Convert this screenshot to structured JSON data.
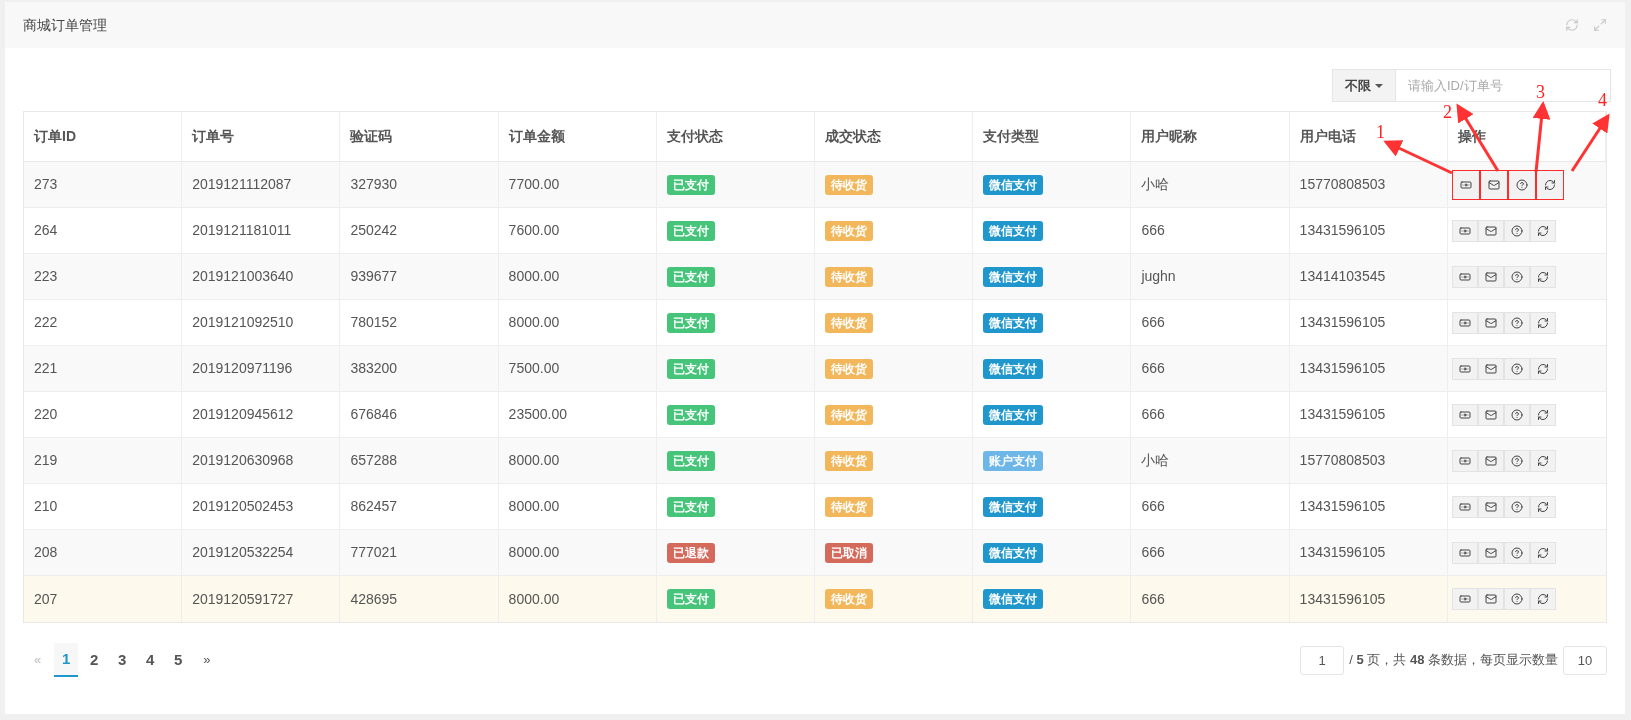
{
  "panel": {
    "title": "商城订单管理"
  },
  "filter": {
    "dropdown": "不限",
    "placeholder": "请输入ID/订单号"
  },
  "table": {
    "columns": [
      "订单ID",
      "订单号",
      "验证码",
      "订单金额",
      "支付状态",
      "成交状态",
      "支付类型",
      "用户昵称",
      "用户电话",
      "操作"
    ],
    "rows": [
      {
        "id": "273",
        "order_no": "2019121112087",
        "code": "327930",
        "amount": "7700.00",
        "pay_status": {
          "text": "已支付",
          "color": "#45c47a"
        },
        "deal_status": {
          "text": "待收货",
          "color": "#f2b65b"
        },
        "pay_type": {
          "text": "微信支付",
          "color": "#1f97cc"
        },
        "nickname": "小哈",
        "phone": "15770808503",
        "highlighted": false,
        "actions_marked": true
      },
      {
        "id": "264",
        "order_no": "2019121181011",
        "code": "250242",
        "amount": "7600.00",
        "pay_status": {
          "text": "已支付",
          "color": "#45c47a"
        },
        "deal_status": {
          "text": "待收货",
          "color": "#f2b65b"
        },
        "pay_type": {
          "text": "微信支付",
          "color": "#1f97cc"
        },
        "nickname": "666",
        "phone": "13431596105",
        "highlighted": false,
        "actions_marked": false
      },
      {
        "id": "223",
        "order_no": "2019121003640",
        "code": "939677",
        "amount": "8000.00",
        "pay_status": {
          "text": "已支付",
          "color": "#45c47a"
        },
        "deal_status": {
          "text": "待收货",
          "color": "#f2b65b"
        },
        "pay_type": {
          "text": "微信支付",
          "color": "#1f97cc"
        },
        "nickname": "jughn",
        "phone": "13414103545",
        "highlighted": false,
        "actions_marked": false
      },
      {
        "id": "222",
        "order_no": "2019121092510",
        "code": "780152",
        "amount": "8000.00",
        "pay_status": {
          "text": "已支付",
          "color": "#45c47a"
        },
        "deal_status": {
          "text": "待收货",
          "color": "#f2b65b"
        },
        "pay_type": {
          "text": "微信支付",
          "color": "#1f97cc"
        },
        "nickname": "666",
        "phone": "13431596105",
        "highlighted": false,
        "actions_marked": false
      },
      {
        "id": "221",
        "order_no": "2019120971196",
        "code": "383200",
        "amount": "7500.00",
        "pay_status": {
          "text": "已支付",
          "color": "#45c47a"
        },
        "deal_status": {
          "text": "待收货",
          "color": "#f2b65b"
        },
        "pay_type": {
          "text": "微信支付",
          "color": "#1f97cc"
        },
        "nickname": "666",
        "phone": "13431596105",
        "highlighted": false,
        "actions_marked": false
      },
      {
        "id": "220",
        "order_no": "2019120945612",
        "code": "676846",
        "amount": "23500.00",
        "pay_status": {
          "text": "已支付",
          "color": "#45c47a"
        },
        "deal_status": {
          "text": "待收货",
          "color": "#f2b65b"
        },
        "pay_type": {
          "text": "微信支付",
          "color": "#1f97cc"
        },
        "nickname": "666",
        "phone": "13431596105",
        "highlighted": false,
        "actions_marked": false
      },
      {
        "id": "219",
        "order_no": "2019120630968",
        "code": "657288",
        "amount": "8000.00",
        "pay_status": {
          "text": "已支付",
          "color": "#45c47a"
        },
        "deal_status": {
          "text": "待收货",
          "color": "#f2b65b"
        },
        "pay_type": {
          "text": "账户支付",
          "color": "#6cb6e8"
        },
        "nickname": "小哈",
        "phone": "15770808503",
        "highlighted": false,
        "actions_marked": false
      },
      {
        "id": "210",
        "order_no": "2019120502453",
        "code": "862457",
        "amount": "8000.00",
        "pay_status": {
          "text": "已支付",
          "color": "#45c47a"
        },
        "deal_status": {
          "text": "待收货",
          "color": "#f2b65b"
        },
        "pay_type": {
          "text": "微信支付",
          "color": "#1f97cc"
        },
        "nickname": "666",
        "phone": "13431596105",
        "highlighted": false,
        "actions_marked": false
      },
      {
        "id": "208",
        "order_no": "2019120532254",
        "code": "777021",
        "amount": "8000.00",
        "pay_status": {
          "text": "已退款",
          "color": "#d46a5c"
        },
        "deal_status": {
          "text": "已取消",
          "color": "#d46a5c"
        },
        "pay_type": {
          "text": "微信支付",
          "color": "#1f97cc"
        },
        "nickname": "666",
        "phone": "13431596105",
        "highlighted": false,
        "actions_marked": false
      },
      {
        "id": "207",
        "order_no": "2019120591727",
        "code": "428695",
        "amount": "8000.00",
        "pay_status": {
          "text": "已支付",
          "color": "#45c47a"
        },
        "deal_status": {
          "text": "待收货",
          "color": "#f2b65b"
        },
        "pay_type": {
          "text": "微信支付",
          "color": "#1f97cc"
        },
        "nickname": "666",
        "phone": "13431596105",
        "highlighted": true,
        "actions_marked": false
      }
    ]
  },
  "pagination": {
    "prev": "«",
    "next": "»",
    "pages": [
      {
        "label": "1",
        "selected": true
      },
      {
        "label": "2",
        "selected": false
      },
      {
        "label": "3",
        "selected": false
      },
      {
        "label": "4",
        "selected": false
      },
      {
        "label": "5",
        "selected": false
      }
    ],
    "current_page": "1",
    "summary": "/ **5** 页，共 **48** 条数据，每页显示数量",
    "page_size": "10"
  },
  "annotations": [
    {
      "label": "1"
    },
    {
      "label": "2"
    },
    {
      "label": "3"
    },
    {
      "label": "4"
    }
  ]
}
